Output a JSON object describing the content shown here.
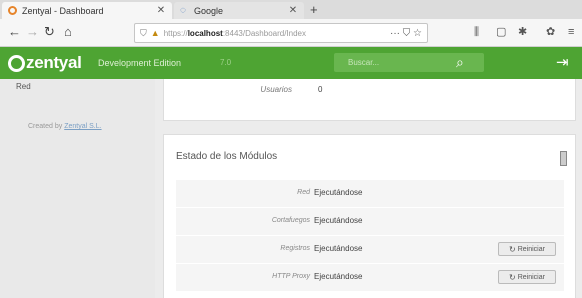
{
  "browser": {
    "tabs": [
      {
        "title": "Zentyal - Dashboard",
        "icon": "zentyal-icon"
      },
      {
        "title": "Google",
        "icon": "google-icon"
      }
    ],
    "url": {
      "prefix": "https://",
      "host": "localhost",
      "rest": ":8443/Dashboard/Index"
    },
    "url_actions": "··· ⛉ ☆"
  },
  "header": {
    "logo": "zentyal",
    "edition": "Development Edition",
    "version": "7.0",
    "search_placeholder": "Buscar..."
  },
  "sidebar": {
    "top_item": "Red",
    "created_by_prefix": "Created by",
    "created_by_link": "Zentyal S.L."
  },
  "info_card": {
    "label": "Usuarios",
    "value": "0"
  },
  "modules": {
    "title": "Estado de los Módulos",
    "rows": [
      {
        "name": "Red",
        "status": "Ejecutándose",
        "button": ""
      },
      {
        "name": "Cortafuegos",
        "status": "Ejecutándose",
        "button": ""
      },
      {
        "name": "Registros",
        "status": "Ejecutándose",
        "button": "Reiniciar"
      },
      {
        "name": "HTTP Proxy",
        "status": "Ejecutándose",
        "button": "Reiniciar"
      }
    ]
  },
  "colors": {
    "header_green": "#4ea433",
    "accent_orange": "#e6842a"
  }
}
